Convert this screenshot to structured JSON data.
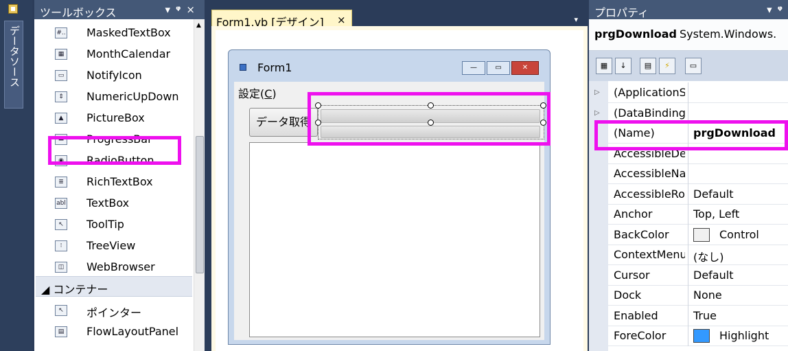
{
  "left_strip": {
    "tab_label": "データソース"
  },
  "toolbox": {
    "title": "ツールボックス",
    "pin": "ᵠ",
    "close": "×",
    "items": [
      {
        "label": "MaskedTextBox",
        "icon": "masked-textbox-icon",
        "glyph": "#.."
      },
      {
        "label": "MonthCalendar",
        "icon": "calendar-icon",
        "glyph": "▦"
      },
      {
        "label": "NotifyIcon",
        "icon": "notify-icon",
        "glyph": "▭"
      },
      {
        "label": "NumericUpDown",
        "icon": "numeric-updown-icon",
        "glyph": "⇕"
      },
      {
        "label": "PictureBox",
        "icon": "picture-icon",
        "glyph": "▲"
      },
      {
        "label": "ProgressBar",
        "icon": "progressbar-icon",
        "glyph": "▬"
      },
      {
        "label": "RadioButton",
        "icon": "radio-icon",
        "glyph": "◉"
      },
      {
        "label": "RichTextBox",
        "icon": "richtextbox-icon",
        "glyph": "≣"
      },
      {
        "label": "TextBox",
        "icon": "textbox-icon",
        "glyph": "abl"
      },
      {
        "label": "ToolTip",
        "icon": "tooltip-icon",
        "glyph": "↖"
      },
      {
        "label": "TreeView",
        "icon": "treeview-icon",
        "glyph": "⁝"
      },
      {
        "label": "WebBrowser",
        "icon": "webbrowser-icon",
        "glyph": "◫"
      }
    ],
    "category": "◢ コンテナー",
    "extra_items": [
      {
        "label": "ポインター",
        "icon": "pointer-icon",
        "glyph": "↖"
      },
      {
        "label": "FlowLayoutPanel",
        "icon": "flowlayout-icon",
        "glyph": "▤"
      }
    ]
  },
  "designer": {
    "tab_label": "Form1.vb [デザイン]",
    "tab_close": "×",
    "tab_dropdown": "▾",
    "form": {
      "title": "Form1",
      "minimize": "—",
      "maximize": "▭",
      "close": "✕",
      "menu_label": "設定(",
      "menu_accel": "C",
      "menu_tail": ")",
      "button_label": "データ取得"
    }
  },
  "properties": {
    "title": "プロパティ",
    "object_name": "prgDownload",
    "object_type": "System.Windows.",
    "rows": [
      {
        "name": "(ApplicationS",
        "value": "",
        "expand": "▷"
      },
      {
        "name": "(DataBindings",
        "value": "",
        "expand": "▷"
      },
      {
        "name": "(Name)",
        "value": "prgDownload",
        "bold": true
      },
      {
        "name": "AccessibleDes",
        "value": ""
      },
      {
        "name": "AccessibleNa",
        "value": ""
      },
      {
        "name": "AccessibleRol",
        "value": "Default"
      },
      {
        "name": "Anchor",
        "value": "Top, Left"
      },
      {
        "name": "BackColor",
        "value": "Control",
        "swatch": "#f0f0f0"
      },
      {
        "name": "ContextMenu",
        "value": "(なし)"
      },
      {
        "name": "Cursor",
        "value": "Default"
      },
      {
        "name": "Dock",
        "value": "None"
      },
      {
        "name": "Enabled",
        "value": "True"
      },
      {
        "name": "ForeColor",
        "value": "Highlight",
        "swatch": "#3399ff"
      }
    ]
  },
  "colors": {
    "highlight_box": "#ee10ee",
    "panel_title": "#445877",
    "ide_bg": "#2b3c59"
  }
}
